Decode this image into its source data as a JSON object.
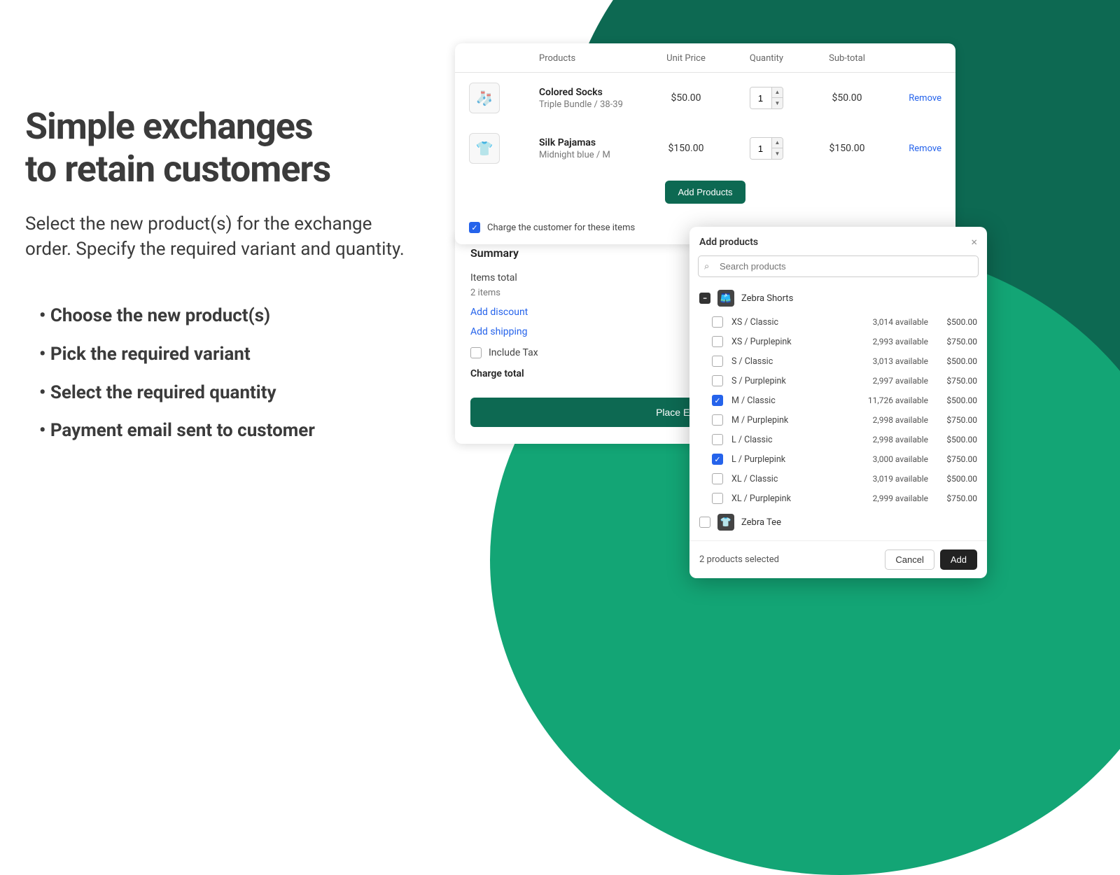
{
  "marketing": {
    "title1": "Simple exchanges",
    "title2": "to retain customers",
    "subtitle": "Select the new product(s) for the exchange order. Specify the required variant and quantity.",
    "bullets": [
      "Choose the new product(s)",
      "Pick the required variant",
      "Select the required quantity",
      "Payment email sent to customer"
    ]
  },
  "table": {
    "headers": {
      "products": "Products",
      "unit_price": "Unit Price",
      "quantity": "Quantity",
      "subtotal": "Sub-total"
    },
    "rows": [
      {
        "name": "Colored Socks",
        "variant": "Triple Bundle / 38-39",
        "price": "$50.00",
        "qty": "1",
        "subtotal": "$50.00",
        "icon": "🧦"
      },
      {
        "name": "Silk Pajamas",
        "variant": "Midnight blue / M",
        "price": "$150.00",
        "qty": "1",
        "subtotal": "$150.00",
        "icon": "👕"
      }
    ],
    "remove_label": "Remove",
    "add_products_btn": "Add Products",
    "charge_label": "Charge the customer for these items"
  },
  "summary": {
    "title": "Summary",
    "items_total_label": "Items total",
    "items_count": "2 items",
    "add_discount": "Add discount",
    "add_shipping": "Add shipping",
    "include_tax": "Include Tax",
    "charge_total": "Charge total",
    "place_btn": "Place Exchange Order"
  },
  "modal": {
    "title": "Add products",
    "search_placeholder": "Search products",
    "product1": {
      "name": "Zebra Shorts"
    },
    "variants": [
      {
        "name": "XS  /  Classic",
        "avail": "3,014 available",
        "price": "$500.00",
        "checked": false
      },
      {
        "name": "XS  /  Purplepink",
        "avail": "2,993 available",
        "price": "$750.00",
        "checked": false
      },
      {
        "name": "S  /  Classic",
        "avail": "3,013 available",
        "price": "$500.00",
        "checked": false
      },
      {
        "name": "S  /  Purplepink",
        "avail": "2,997 available",
        "price": "$750.00",
        "checked": false
      },
      {
        "name": "M  /  Classic",
        "avail": "11,726 available",
        "price": "$500.00",
        "checked": true
      },
      {
        "name": "M  /  Purplepink",
        "avail": "2,998 available",
        "price": "$750.00",
        "checked": false
      },
      {
        "name": "L  /  Classic",
        "avail": "2,998 available",
        "price": "$500.00",
        "checked": false
      },
      {
        "name": "L  /  Purplepink",
        "avail": "3,000 available",
        "price": "$750.00",
        "checked": true
      },
      {
        "name": "XL  /  Classic",
        "avail": "3,019 available",
        "price": "$500.00",
        "checked": false
      },
      {
        "name": "XL  /  Purplepink",
        "avail": "2,999 available",
        "price": "$750.00",
        "checked": false
      }
    ],
    "product2": {
      "name": "Zebra Tee"
    },
    "selected_text": "2 products selected",
    "cancel": "Cancel",
    "add": "Add"
  }
}
